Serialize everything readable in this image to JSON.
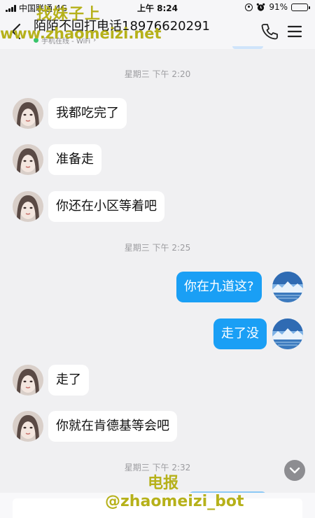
{
  "status_bar": {
    "carrier": "中国联通",
    "network": "4G",
    "time": "上午 8:24",
    "battery": "91%",
    "battery_level": 0.91
  },
  "header": {
    "title": "陌陌不回打电话18976620291",
    "subtitle": "手机在线 - WiFi",
    "subtitle_arrow": "›"
  },
  "watermarks": {
    "top_line": "找妹子上",
    "url": "www.zhaomeizi.net",
    "bottom_line": "电报",
    "bot": "@zhaomeizi_bot"
  },
  "chat": {
    "timestamps": [
      "星期三 下午 2:20",
      "星期三 下午 2:25",
      "星期三 下午 2:32"
    ],
    "messages": [
      {
        "side": "in",
        "text": "我都吃完了"
      },
      {
        "side": "in",
        "text": "准备走"
      },
      {
        "side": "in",
        "text": "你还在小区等着吧"
      },
      {
        "side": "out",
        "text": "你在九道这?"
      },
      {
        "side": "out",
        "text": "走了没"
      },
      {
        "side": "in",
        "text": "走了"
      },
      {
        "side": "in",
        "text": "你就在肯德基等会吧"
      }
    ]
  },
  "icons": [
    "back-arrow-icon",
    "phone-icon",
    "menu-icon",
    "chevron-down-icon",
    "signal-icon",
    "alarm-icon",
    "lock-rotation-icon",
    "battery-icon"
  ],
  "colors": {
    "outgoing_bubble": "#1a9ff5",
    "incoming_bubble": "#ffffff",
    "background": "#f0f0f2",
    "watermark": "#b6b11a",
    "online": "#39c46b"
  }
}
